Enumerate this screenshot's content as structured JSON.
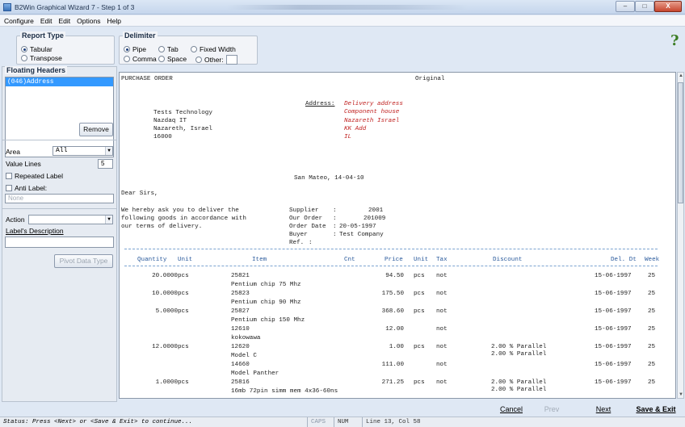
{
  "window": {
    "title": "B2Win Graphical Wizard 7 - Step 1 of 3",
    "controls": [
      "–",
      "□",
      "X"
    ]
  },
  "menu": [
    "Configure",
    "Edit",
    "Edit",
    "Options",
    "Help"
  ],
  "report_type": {
    "title": "Report Type",
    "options": [
      {
        "label": "Tabular",
        "selected": true
      },
      {
        "label": "Transpose",
        "selected": false
      }
    ]
  },
  "delimiter": {
    "title": "Delimiter",
    "options": [
      {
        "label": "Pipe",
        "selected": true
      },
      {
        "label": "Tab",
        "selected": false
      },
      {
        "label": "Fixed Width",
        "selected": false
      },
      {
        "label": "Comma",
        "selected": false
      },
      {
        "label": "Space",
        "selected": false
      },
      {
        "label": "Other:",
        "selected": false
      }
    ]
  },
  "help_glyph": "?",
  "floating_headers": {
    "title": "Floating Headers",
    "items": [
      "(046)Address"
    ],
    "remove_label": "Remove"
  },
  "props": {
    "area_label": "Area",
    "area_value": "All",
    "value_lines_label": "Value Lines",
    "value_lines_value": "5",
    "repeated_label": "Repeated Label",
    "anti_label": "Anti Label:",
    "anti_placeholder": "None",
    "action_label": "Action",
    "action_value": "",
    "desc_label": "Label's Description",
    "desc_value": "",
    "pivot_label": "Pivot Data Type"
  },
  "document": {
    "header_left": "PURCHASE ORDER",
    "header_right": "Original",
    "company": [
      "Tests Technology",
      "Nazdaq IT",
      "Nazareth, Israel",
      "16000"
    ],
    "address_label": "Address:",
    "address_lines": [
      "Delivery address",
      "Component house",
      "Nazareth Israel",
      "KK Add",
      "IL"
    ],
    "place_date": "San Mateo, 14-04-10",
    "greeting": "Dear Sirs,",
    "intro": [
      "We hereby ask you to deliver the",
      "following goods in accordance with",
      "our terms of delivery."
    ],
    "info": [
      {
        "k": "Supplier",
        "v": "2001"
      },
      {
        "k": "Our Order",
        "v": "201009"
      },
      {
        "k": "Order Date",
        "v": "20-05-1997"
      },
      {
        "k": "Buyer",
        "v": "Test Company"
      },
      {
        "k": "Ref.",
        "v": ""
      }
    ],
    "columns": [
      "Quantity",
      "Unit",
      "Item",
      "Cnt",
      "Price",
      "Unit",
      "Tax",
      "Discount",
      "Del. Dt",
      "Week"
    ],
    "rows": [
      {
        "qty": "20.0000",
        "unit": "pcs",
        "item": "25821",
        "price": "94.50",
        "punit": "pcs",
        "tax": "not",
        "disc": "",
        "date": "15-06-1997",
        "week": "25",
        "desc": "Pentium chip 75 Mhz"
      },
      {
        "qty": "10.0000",
        "unit": "pcs",
        "item": "25823",
        "price": "175.50",
        "punit": "pcs",
        "tax": "not",
        "disc": "",
        "date": "15-06-1997",
        "week": "25",
        "desc": "Pentium chip 90 Mhz"
      },
      {
        "qty": "5.0000",
        "unit": "pcs",
        "item": "25827",
        "price": "368.60",
        "punit": "pcs",
        "tax": "not",
        "disc": "",
        "date": "15-06-1997",
        "week": "25",
        "desc": "Pentium chip 150 Mhz"
      },
      {
        "qty": "",
        "unit": "",
        "item": "12610",
        "price": "12.00",
        "punit": "",
        "tax": "not",
        "disc": "",
        "date": "15-06-1997",
        "week": "25",
        "desc": "kokowawa"
      },
      {
        "qty": "12.0000",
        "unit": "pcs",
        "item": "12620",
        "price": "1.00",
        "punit": "pcs",
        "tax": "not",
        "disc": "2.00 % Parallel",
        "disc2": "2.00 % Parallel",
        "date": "15-06-1997",
        "week": "25",
        "desc": "Model C"
      },
      {
        "qty": "",
        "unit": "",
        "item": "14660",
        "price": "111.00",
        "punit": "",
        "tax": "not",
        "disc": "",
        "date": "15-06-1997",
        "week": "25",
        "desc": "Model Panther"
      },
      {
        "qty": "1.0000",
        "unit": "pcs",
        "item": "25816",
        "price": "271.25",
        "punit": "pcs",
        "tax": "not",
        "disc": "2.00 % Parallel",
        "disc2": "2.00 % Parallel",
        "date": "15-06-1997",
        "week": "25",
        "desc": "16mb 72pin simm mem 4x36-60ns"
      }
    ]
  },
  "buttons": {
    "cancel": "Cancel",
    "prev": "Prev",
    "next": "Next",
    "save_exit": "Save & Exit"
  },
  "status": {
    "message": "Status: Press <Next> or <Save & Exit> to continue...",
    "caps": "CAPS",
    "num": "NUM",
    "position": "Line 13, Col 58"
  }
}
